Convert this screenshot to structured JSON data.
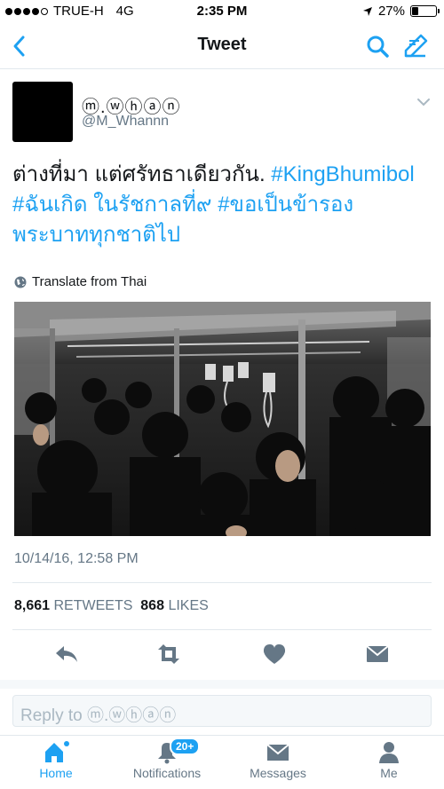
{
  "status_bar": {
    "carrier": "TRUE-H",
    "network": "4G",
    "time": "2:35 PM",
    "battery": "27%",
    "battery_level": 0.27
  },
  "nav": {
    "title": "Tweet"
  },
  "tweet": {
    "display_name": "ⓜ.ⓦⓗⓐⓝ",
    "username": "@M_Whannn",
    "text_plain_1": "ต่างที่มา แต่ศรัทธาเดียวกัน. ",
    "tag_1": "#KingBhumibol",
    "tag_2": "#ฉันเกิด ในรัชกาลที่๙",
    "text_plain_2": " ",
    "tag_3": "#ขอเป็นข้ารอง",
    "tag_3b": "พระบาททุกชาติไป",
    "translate": "Translate from Thai",
    "date": "10/14/16, 12:58 PM",
    "retweets_count": "8,661",
    "retweets_label": "RETWEETS",
    "likes_count": "868",
    "likes_label": "LIKES"
  },
  "reply": {
    "placeholder": "Reply to ⓜ.ⓦⓗⓐⓝ"
  },
  "tabs": [
    {
      "label": "Home",
      "icon": "home-icon",
      "active": true
    },
    {
      "label": "Notifications",
      "icon": "bell-icon",
      "badge": "20+"
    },
    {
      "label": "Messages",
      "icon": "envelope-icon"
    },
    {
      "label": "Me",
      "icon": "person-icon"
    }
  ],
  "colors": {
    "accent": "#1da1f2",
    "muted": "#657786",
    "border": "#e1e8ed"
  }
}
